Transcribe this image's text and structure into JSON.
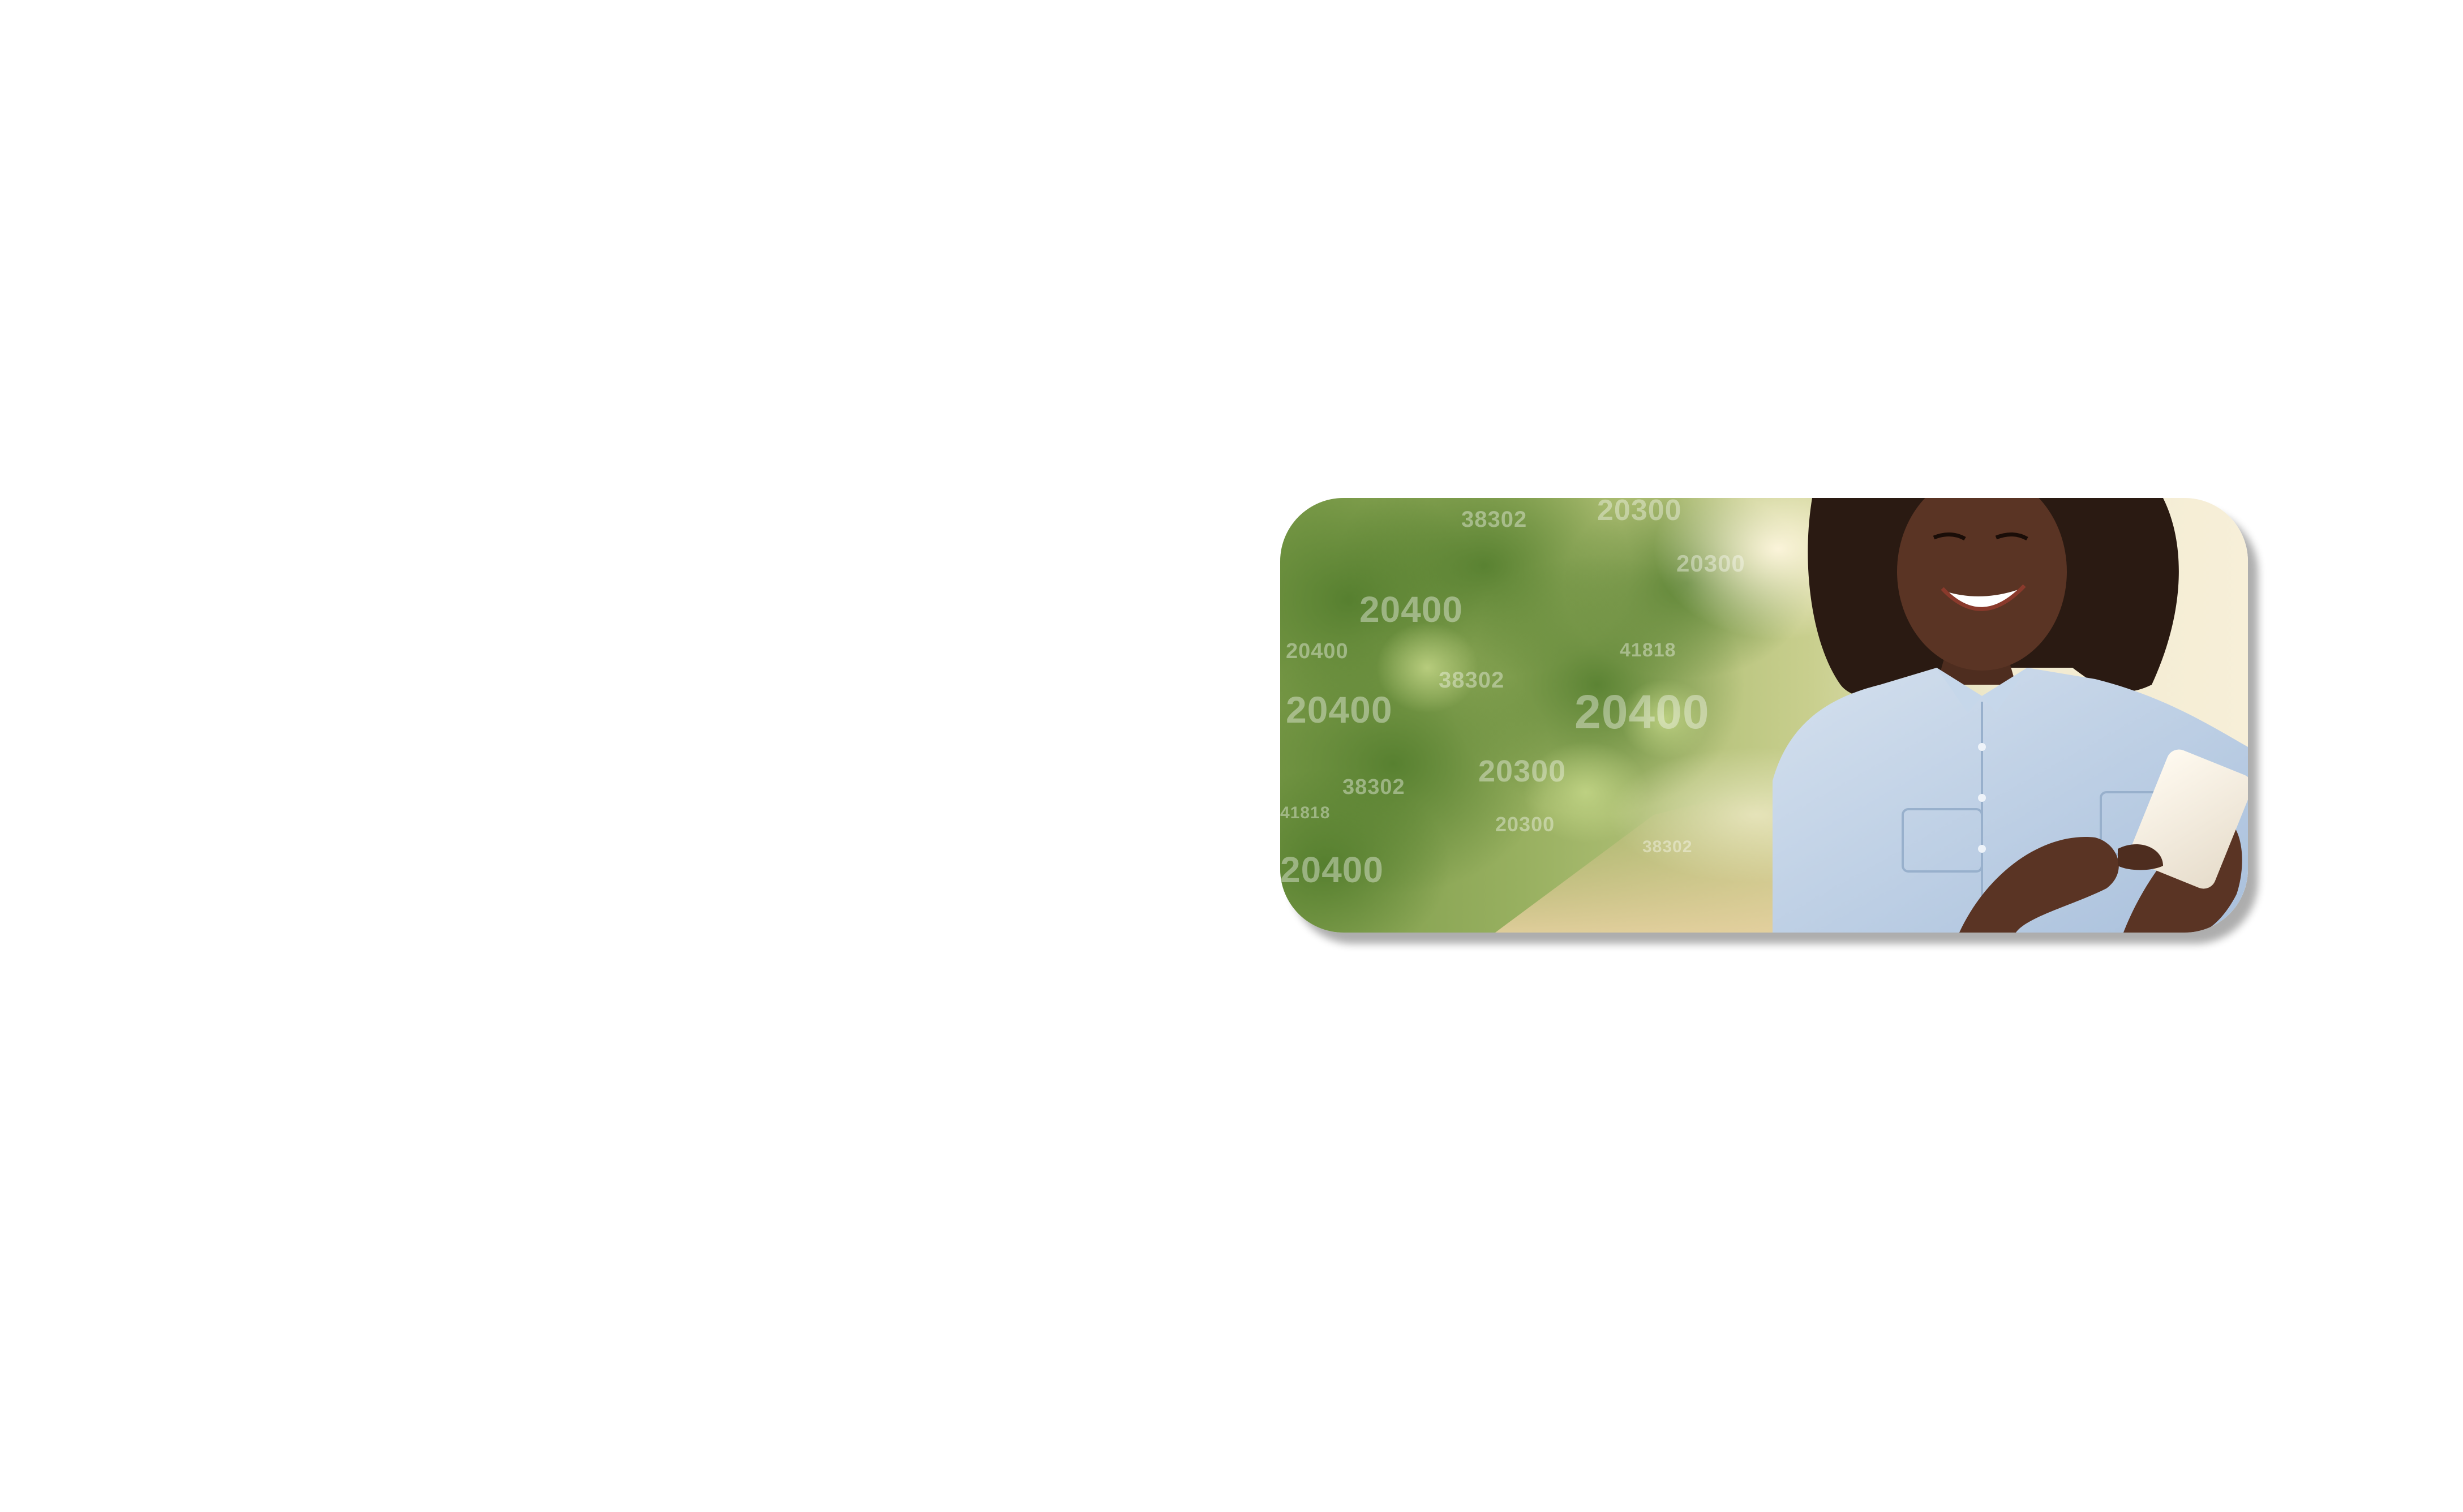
{
  "hero": {
    "image_description_icon": "photo-woman-with-phone",
    "overlay_numbers": [
      "20300",
      "38302",
      "20300",
      "20400",
      "20400",
      "41818",
      "38302",
      "20400",
      "20400",
      "20300",
      "38302",
      "20300",
      "20400",
      "41818",
      "38302"
    ],
    "colors": {
      "foliage": "#6f8f3a",
      "path": "#e8d2a6",
      "shirt": "#bcd0e6",
      "skin": "#5a3424",
      "hair": "#2a1a12"
    }
  }
}
